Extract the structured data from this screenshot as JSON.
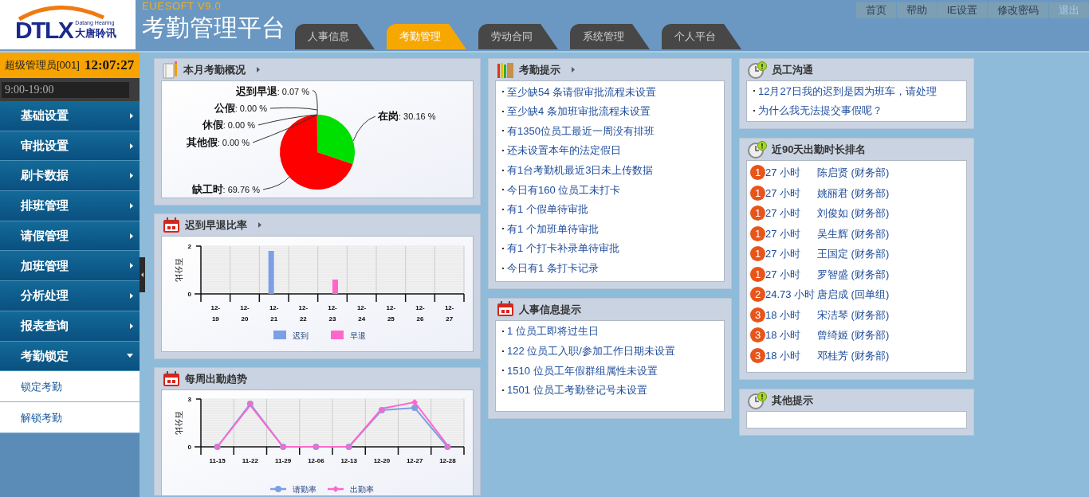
{
  "header": {
    "logo": {
      "mark": "DTLX",
      "english": "Datang Hearing",
      "chinese": "大唐聆讯"
    },
    "version": "EUESOFT V9.0",
    "title": "考勤管理平台",
    "tabs": [
      {
        "label": "人事信息",
        "selected": false
      },
      {
        "label": "考勤管理",
        "selected": true
      },
      {
        "label": "劳动合同",
        "selected": false
      },
      {
        "label": "系统管理",
        "selected": false
      },
      {
        "label": "个人平台",
        "selected": false
      }
    ],
    "links": [
      {
        "label": "首页",
        "kind": "link"
      },
      {
        "label": "帮助",
        "kind": "link"
      },
      {
        "label": "IE设置",
        "kind": "link"
      },
      {
        "label": "修改密码",
        "kind": "link"
      },
      {
        "label": "退出",
        "kind": "exit"
      }
    ]
  },
  "sidebar": {
    "user": "超级管理员[001]",
    "time": "12:07:27",
    "shift": "9:00-19:00",
    "menu": [
      {
        "label": "基础设置",
        "expanded": false
      },
      {
        "label": "审批设置",
        "expanded": false
      },
      {
        "label": "刷卡数据",
        "expanded": false
      },
      {
        "label": "排班管理",
        "expanded": false
      },
      {
        "label": "请假管理",
        "expanded": false
      },
      {
        "label": "加班管理",
        "expanded": false
      },
      {
        "label": "分析处理",
        "expanded": false
      },
      {
        "label": "报表查询",
        "expanded": false
      },
      {
        "label": "考勤锁定",
        "expanded": true,
        "children": [
          {
            "label": "锁定考勤"
          },
          {
            "label": "解锁考勤"
          }
        ]
      }
    ]
  },
  "columns": [
    [
      {
        "title": "本月考勤概况",
        "kind": "pie",
        "more": true,
        "chart_data": {
          "type": "pie",
          "categories": [
            "在岗",
            "缺工时",
            "其他假",
            "休假",
            "公假",
            "迟到早退"
          ],
          "values": [
            30.16,
            69.76,
            0,
            0,
            0,
            0.07
          ],
          "colors": [
            "#00e000",
            "#ff0000",
            null,
            null,
            null,
            "#ff8800"
          ],
          "value_labels": [
            ": 30.16 %",
            ": 69.76 %",
            ": 0.00 %",
            ": 0.00 %",
            ": 0.00 %",
            ": 0.07 %"
          ],
          "data_labels": true
        }
      },
      {
        "title": "迟到早退比率",
        "kind": "bar",
        "more": true,
        "chart_data": {
          "type": "bar",
          "ylabel": "百分比",
          "categories": [
            "12-19",
            "12-20",
            "12-21",
            "12-22",
            "12-23",
            "12-24",
            "12-25",
            "12-26",
            "12-27"
          ],
          "ylim": [
            0,
            2
          ],
          "yticks": [
            0,
            2
          ],
          "legend": "bottom",
          "series": [
            {
              "name": "迟到",
              "color": "#7ba0e4",
              "values": [
                0,
                0,
                1.8,
                0,
                0,
                0,
                0,
                0,
                0
              ]
            },
            {
              "name": "早退",
              "color": "#ff66cc",
              "values": [
                0,
                0,
                0,
                0,
                0.6,
                0,
                0,
                0,
                0
              ]
            }
          ]
        }
      },
      {
        "title": "每周出勤趋势",
        "kind": "line",
        "more": false,
        "chart_data": {
          "type": "line",
          "ylabel": "百分比",
          "categories": [
            "11-15",
            "11-22",
            "11-29",
            "12-06",
            "12-13",
            "12-20",
            "12-27",
            "12-28"
          ],
          "ylim": [
            0,
            3
          ],
          "yticks": [
            0,
            3
          ],
          "legend": "bottom",
          "series": [
            {
              "name": "请勤率",
              "color": "#7ba0e4",
              "marker": "circle",
              "values": [
                0,
                2.7,
                0,
                0,
                0,
                2.3,
                2.45,
                0
              ]
            },
            {
              "name": "出勤率",
              "color": "#ff66cc",
              "marker": "diamond",
              "values": [
                0,
                2.6,
                0,
                0,
                0,
                2.4,
                2.8,
                0.1
              ]
            }
          ]
        }
      }
    ],
    [
      {
        "title": "考勤提示",
        "kind": "alerts",
        "more": true,
        "items": [
          "至少缺54 条请假审批流程未设置",
          "至少缺4 条加班审批流程未设置",
          "有1350位员工最近一周没有排班",
          "还未设置本年的法定假日",
          "有1台考勤机最近3日未上传数据",
          "今日有160 位员工未打卡",
          "有1 个假单待审批",
          "有1 个加班单待审批",
          "有1 个打卡补录单待审批",
          "今日有1 条打卡记录"
        ]
      },
      {
        "title": "人事信息提示",
        "kind": "notices",
        "more": false,
        "items": [
          "1 位员工即将过生日",
          "122 位员工入职/参加工作日期未设置",
          "1510 位员工年假群组属性未设置",
          "1501 位员工考勤登记号未设置"
        ]
      }
    ],
    [
      {
        "title": "员工沟通",
        "kind": "messages",
        "more": false,
        "items": [
          "12月27日我的迟到是因为班车，请处理",
          "为什么我无法提交事假呢？"
        ]
      },
      {
        "title": "近90天出勤时长排名",
        "kind": "ranking",
        "more": false,
        "rows": [
          {
            "rank": "1",
            "hours": "27 小时",
            "name": "陈启贤 (财务部)"
          },
          {
            "rank": "1",
            "hours": "27 小时",
            "name": "姚丽君 (财务部)"
          },
          {
            "rank": "1",
            "hours": "27 小时",
            "name": "刘俊如 (财务部)"
          },
          {
            "rank": "1",
            "hours": "27 小时",
            "name": "吴生辉 (财务部)"
          },
          {
            "rank": "1",
            "hours": "27 小时",
            "name": "王国定 (财务部)"
          },
          {
            "rank": "1",
            "hours": "27 小时",
            "name": "罗智盛 (财务部)"
          },
          {
            "rank": "2",
            "hours": "24.73 小时",
            "name": "唐启成 (回单组)"
          },
          {
            "rank": "3",
            "hours": "18 小时",
            "name": "宋洁琴 (财务部)"
          },
          {
            "rank": "3",
            "hours": "18 小时",
            "name": "曾绮姬 (财务部)"
          },
          {
            "rank": "3",
            "hours": "18 小时",
            "name": "邓桂芳 (财务部)"
          }
        ]
      },
      {
        "title": "其他提示",
        "kind": "blank",
        "more": false
      }
    ]
  ]
}
